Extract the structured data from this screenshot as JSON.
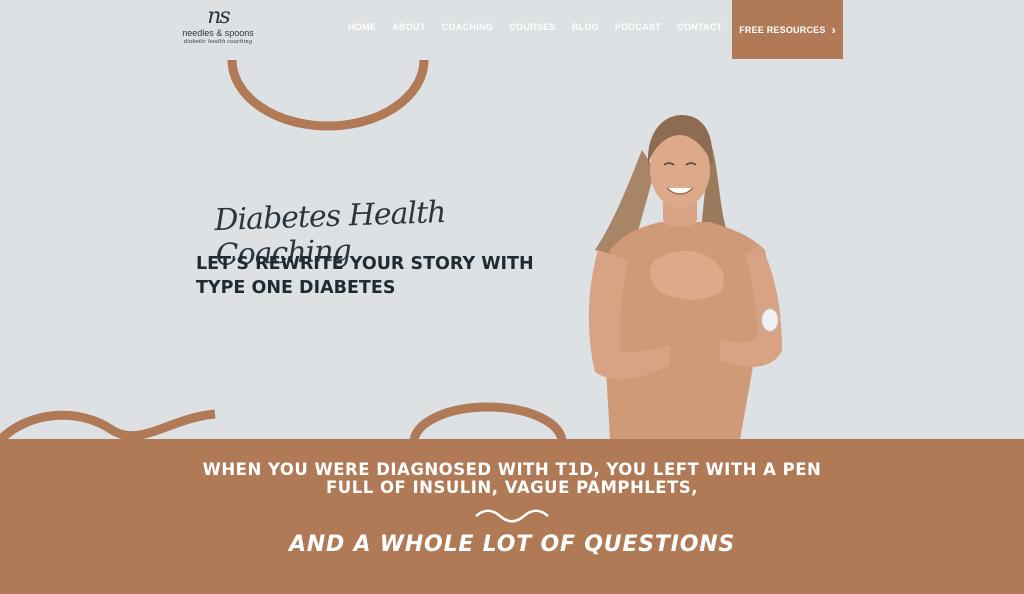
{
  "logo": {
    "mark": "ns",
    "name": "needles & spoons",
    "tagline": "diabetic health coaching"
  },
  "nav": {
    "items": [
      {
        "label": "HOME"
      },
      {
        "label": "ABOUT"
      },
      {
        "label": "COACHING"
      },
      {
        "label": "COURSES"
      },
      {
        "label": "BLOG"
      },
      {
        "label": "PODCAST"
      },
      {
        "label": "CONTACT"
      }
    ],
    "cta_label": "FREE RESOURCES",
    "cta_icon": "chevron-right-icon"
  },
  "hero": {
    "script_title": "Diabetes Health Coaching",
    "headline_line1": "LET'S REWRITE YOUR STORY WITH",
    "headline_line2": "TYPE ONE DIABETES"
  },
  "band": {
    "line1": "WHEN YOU WERE DIAGNOSED WITH T1D, YOU LEFT WITH A PEN",
    "line2": "FULL OF INSULIN, VAGUE PAMPHLETS,",
    "question": "AND A WHOLE LOT OF QUESTIONS"
  },
  "colors": {
    "background": "#dde1e3",
    "accent": "#b07a57",
    "text_dark": "#1f2b33",
    "nav_text": "#ffffff"
  }
}
